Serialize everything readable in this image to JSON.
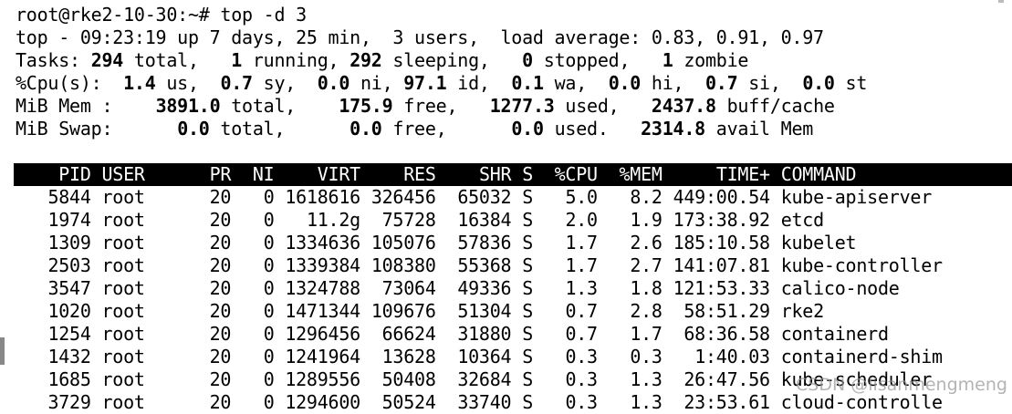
{
  "colors": {
    "background": "#ffffff",
    "text": "#000000",
    "header_bar": "#000000",
    "header_text": "#ffffff"
  },
  "prompt": "root@rke2-10-30:~# top -d 3",
  "summary": {
    "top_line": "top - 09:23:19 up 7 days, 25 min,  3 users,  load average: 0.83, 0.91, 0.97",
    "tasks": {
      "label": "Tasks:",
      "total": "294",
      "running": "1",
      "sleeping": "292",
      "stopped": "0",
      "zombie": "1"
    },
    "cpu": {
      "label": "%Cpu(s):",
      "us": "1.4",
      "sy": "0.7",
      "ni": "0.0",
      "id": "97.1",
      "wa": "0.1",
      "hi": "0.0",
      "si": "0.7",
      "st": "0.0"
    },
    "mem": {
      "label": "MiB Mem :",
      "total": "3891.0",
      "free": "175.9",
      "used": "1277.3",
      "buff_cache": "2437.8"
    },
    "swap": {
      "label": "MiB Swap:",
      "total": "0.0",
      "free": "0.0",
      "used": "0.0",
      "avail_mem": "2314.8"
    }
  },
  "table": {
    "columns": [
      "PID",
      "USER",
      "PR",
      "NI",
      "VIRT",
      "RES",
      "SHR",
      "S",
      "%CPU",
      "%MEM",
      "TIME+",
      "COMMAND"
    ],
    "rows": [
      [
        "5844",
        "root",
        "20",
        "0",
        "1618616",
        "326456",
        "65032",
        "S",
        "5.0",
        "8.2",
        "449:00.54",
        "kube-apiserver"
      ],
      [
        "1974",
        "root",
        "20",
        "0",
        "11.2g",
        "75728",
        "16384",
        "S",
        "2.0",
        "1.9",
        "173:38.92",
        "etcd"
      ],
      [
        "1309",
        "root",
        "20",
        "0",
        "1334636",
        "105076",
        "57836",
        "S",
        "1.7",
        "2.6",
        "185:10.58",
        "kubelet"
      ],
      [
        "2503",
        "root",
        "20",
        "0",
        "1339384",
        "108380",
        "55368",
        "S",
        "1.7",
        "2.7",
        "141:07.81",
        "kube-controller"
      ],
      [
        "3547",
        "root",
        "20",
        "0",
        "1324788",
        "73064",
        "49336",
        "S",
        "1.3",
        "1.8",
        "121:53.33",
        "calico-node"
      ],
      [
        "1020",
        "root",
        "20",
        "0",
        "1471344",
        "109676",
        "51304",
        "S",
        "0.7",
        "2.8",
        "58:51.29",
        "rke2"
      ],
      [
        "1254",
        "root",
        "20",
        "0",
        "1296456",
        "66624",
        "31880",
        "S",
        "0.7",
        "1.7",
        "68:36.58",
        "containerd"
      ],
      [
        "1432",
        "root",
        "20",
        "0",
        "1241964",
        "13628",
        "10364",
        "S",
        "0.3",
        "0.3",
        "1:40.03",
        "containerd-shim"
      ],
      [
        "1685",
        "root",
        "20",
        "0",
        "1289556",
        "50408",
        "32684",
        "S",
        "0.3",
        "1.3",
        "26:47.56",
        "kube-scheduler"
      ],
      [
        "3729",
        "root",
        "20",
        "0",
        "1294600",
        "50524",
        "33740",
        "S",
        "0.3",
        "1.3",
        "23:53.61",
        "cloud-controlle"
      ]
    ]
  },
  "watermark": "CSDN @lisanmengmeng"
}
